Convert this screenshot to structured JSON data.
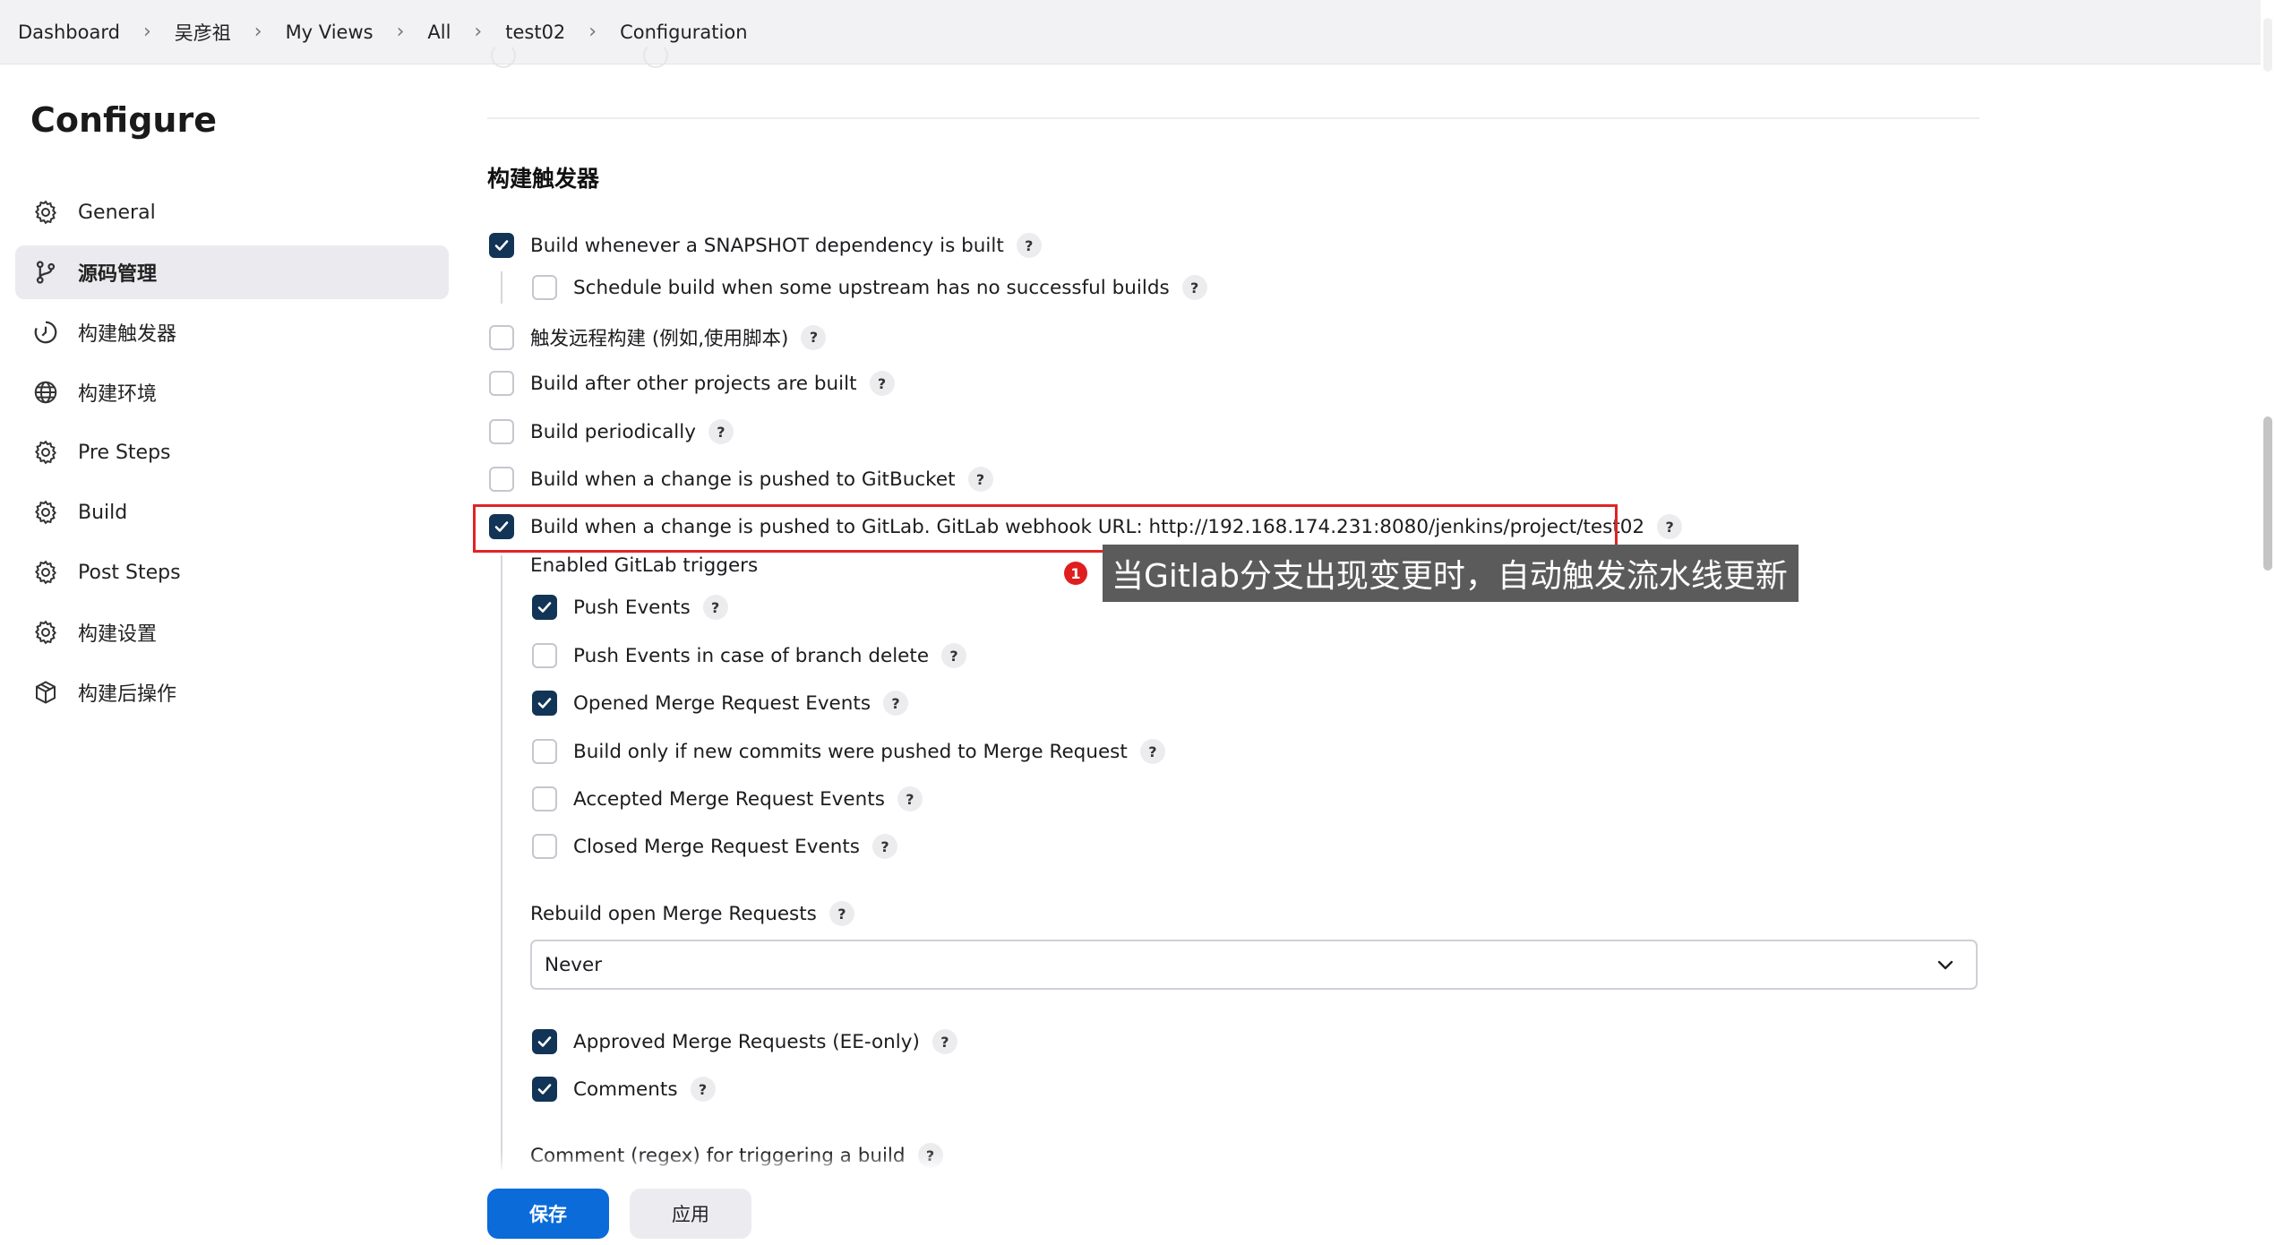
{
  "breadcrumb": [
    "Dashboard",
    "吴彦祖",
    "My Views",
    "All",
    "test02",
    "Configuration"
  ],
  "sidebar": {
    "title": "Configure",
    "items": [
      {
        "label": "General",
        "icon": "gear-icon"
      },
      {
        "label": "源码管理",
        "icon": "branch-icon",
        "active": true
      },
      {
        "label": "构建触发器",
        "icon": "clock-icon"
      },
      {
        "label": "构建环境",
        "icon": "globe-icon"
      },
      {
        "label": "Pre Steps",
        "icon": "gear-icon"
      },
      {
        "label": "Build",
        "icon": "gear-icon"
      },
      {
        "label": "Post Steps",
        "icon": "gear-icon"
      },
      {
        "label": "构建设置",
        "icon": "gear-icon"
      },
      {
        "label": "构建后操作",
        "icon": "cube-icon"
      }
    ]
  },
  "main": {
    "section_title": "构建触发器",
    "triggers": [
      {
        "label": "Build whenever a SNAPSHOT dependency is built",
        "checked": true
      },
      {
        "label": "Schedule build when some upstream has no successful builds",
        "checked": false
      },
      {
        "label": "触发远程构建 (例如,使用脚本)",
        "checked": false
      },
      {
        "label": "Build after other projects are built",
        "checked": false
      },
      {
        "label": "Build periodically",
        "checked": false
      },
      {
        "label": "Build when a change is pushed to GitBucket",
        "checked": false
      },
      {
        "label": "Build when a change is pushed to GitLab. GitLab webhook URL: http://192.168.174.231:8080/jenkins/project/test02",
        "checked": true
      }
    ],
    "gitlab_triggers_label": "Enabled GitLab triggers",
    "gitlab_triggers": [
      {
        "label": "Push Events",
        "checked": true
      },
      {
        "label": "Push Events in case of branch delete",
        "checked": false
      },
      {
        "label": "Opened Merge Request Events",
        "checked": true
      },
      {
        "label": "Build only if new commits were pushed to Merge Request",
        "checked": false
      },
      {
        "label": "Accepted Merge Request Events",
        "checked": false
      },
      {
        "label": "Closed Merge Request Events",
        "checked": false
      }
    ],
    "rebuild_label": "Rebuild open Merge Requests",
    "rebuild_value": "Never",
    "extra_options": [
      {
        "label": "Approved Merge Requests (EE-only)",
        "checked": true
      },
      {
        "label": "Comments",
        "checked": true
      }
    ],
    "comment_regex_label": "Comment (regex) for triggering a build",
    "help_glyph": "?"
  },
  "annotation": {
    "badge": "1",
    "text": "当Gitlab分支出现变更时，自动触发流水线更新",
    "color": "#e02424"
  },
  "footer": {
    "save_label": "保存",
    "apply_label": "应用"
  },
  "colors": {
    "accent": "#0b6bd9",
    "checkbox_checked": "#123456"
  }
}
